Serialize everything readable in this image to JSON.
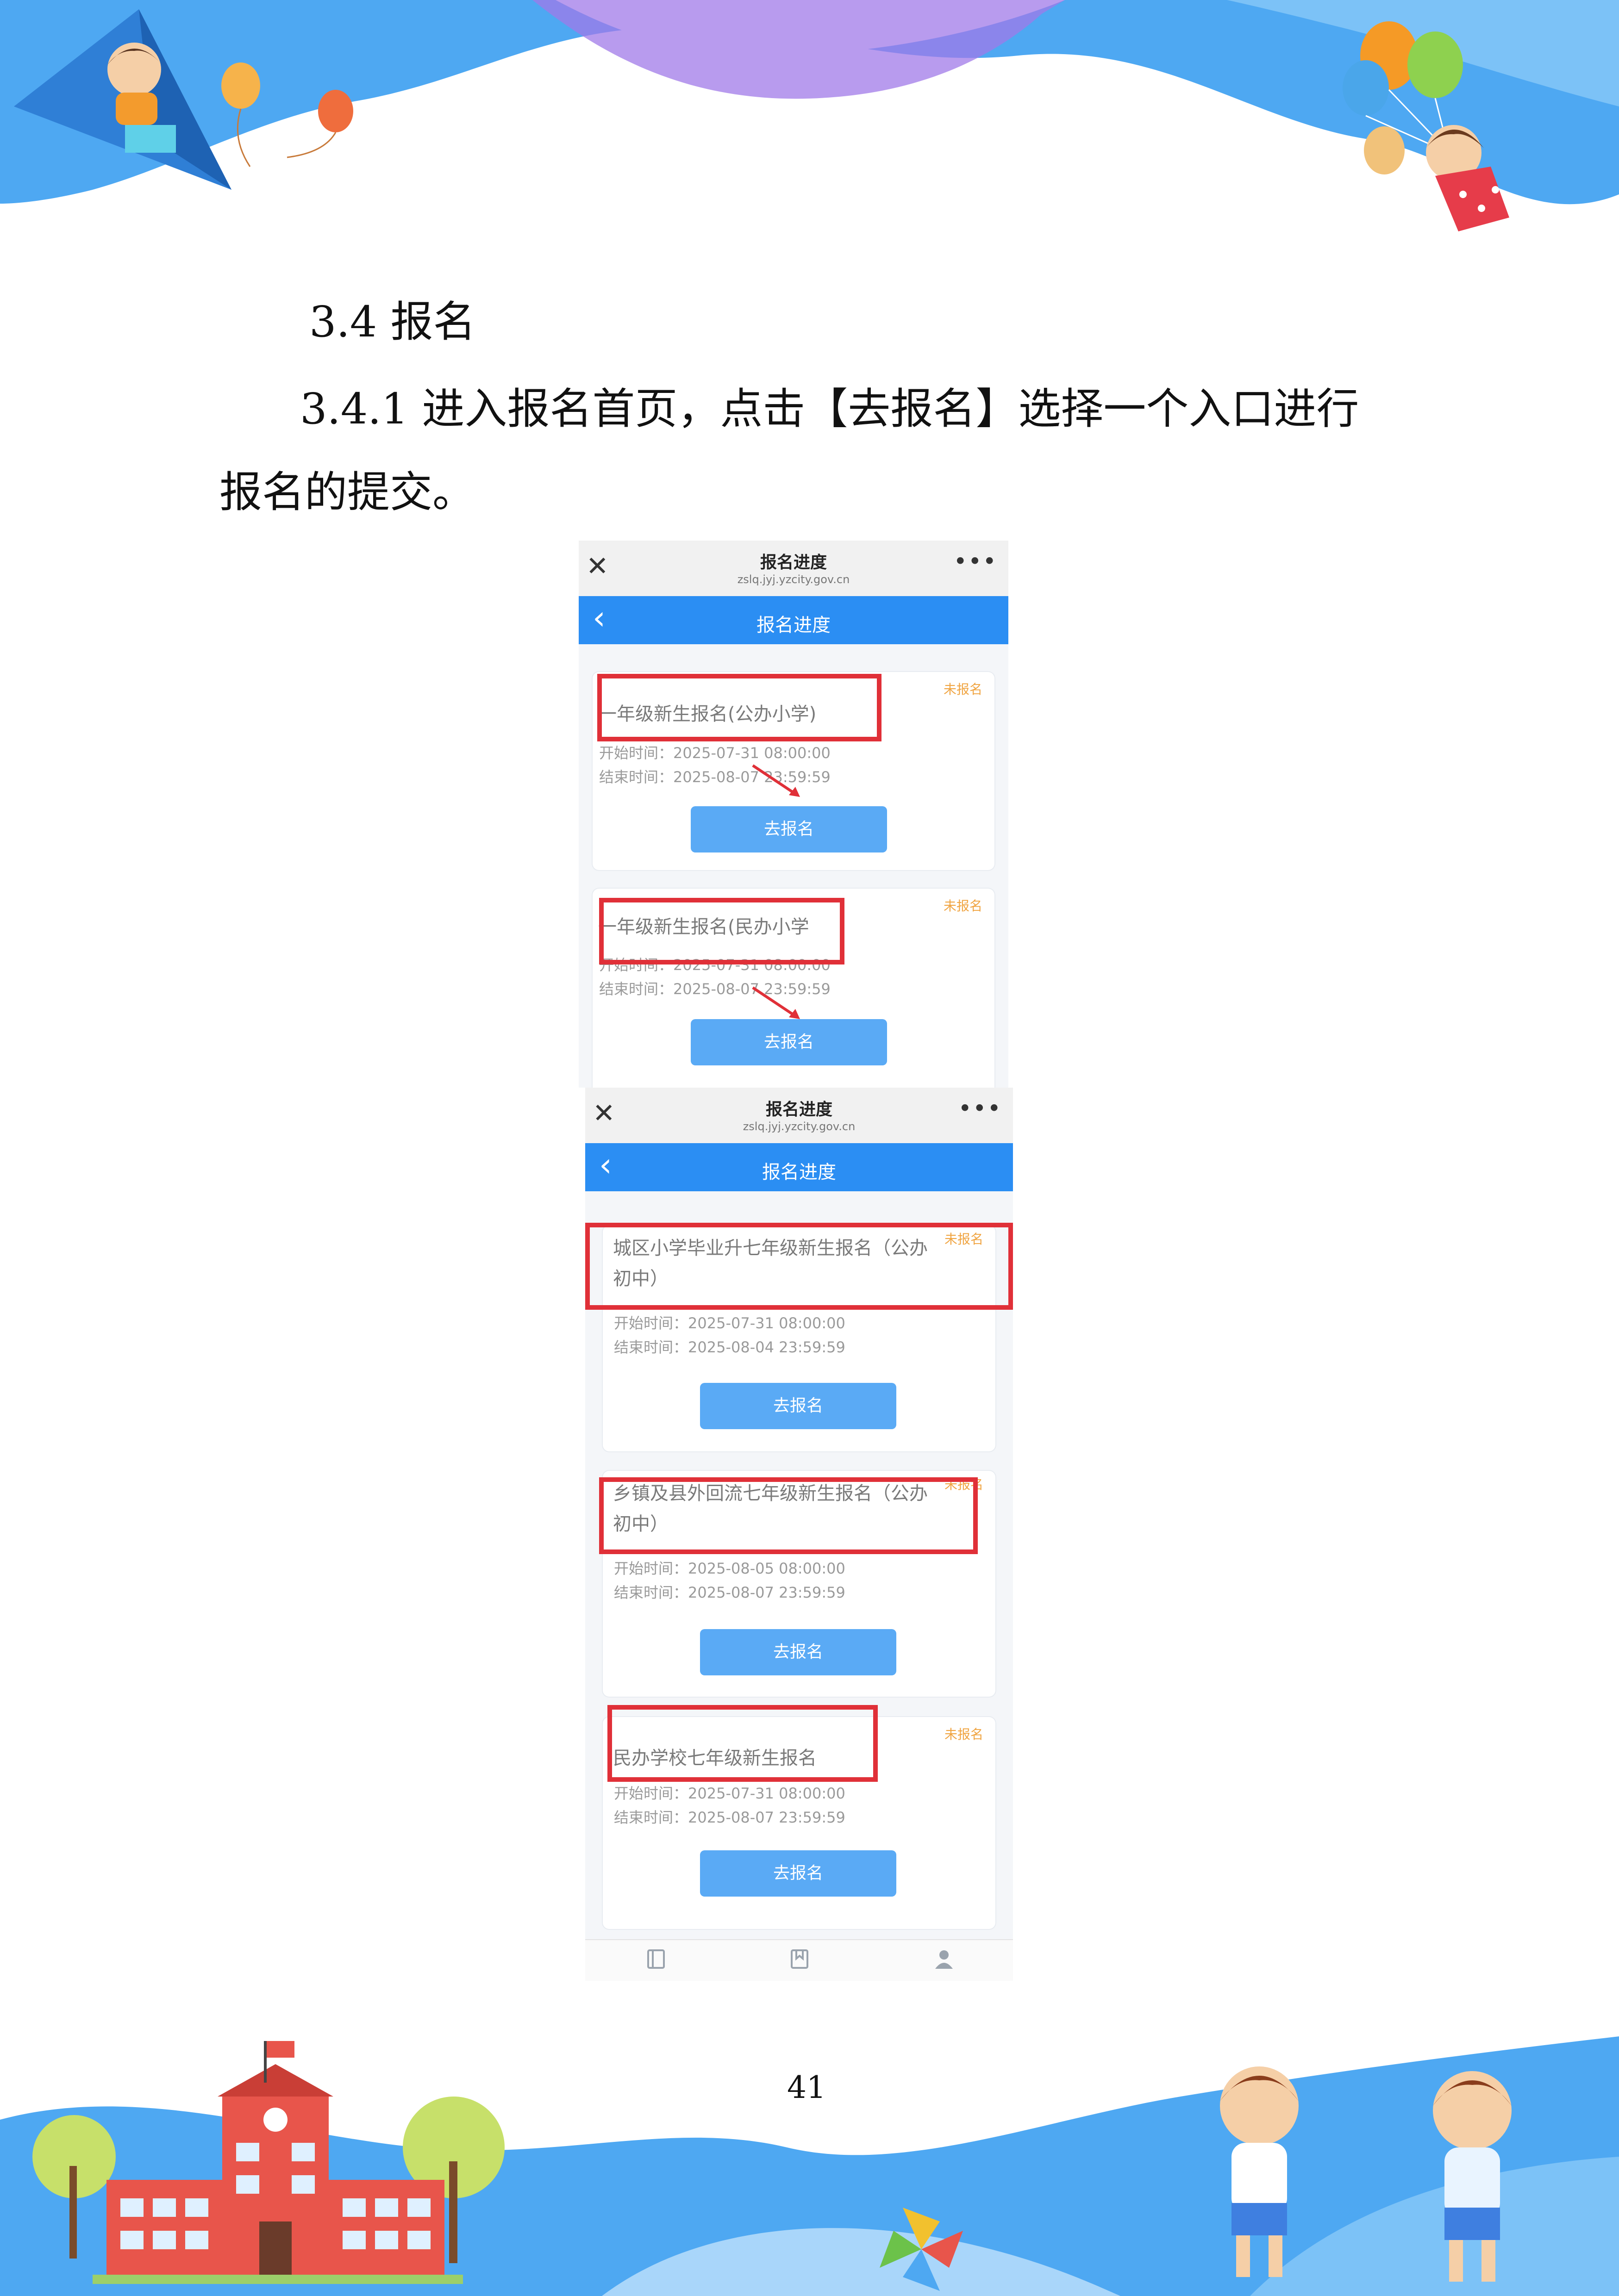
{
  "document": {
    "section_heading": "3.4 报名",
    "paragraph_line1": "3.4.1 进入报名首页，点击【去报名】选择一个入口进行",
    "paragraph_line2": "报名的提交。",
    "page_number": "41"
  },
  "colors": {
    "nav_blue": "#2b8ef3",
    "button_blue": "#5aaaf5",
    "highlight_red": "#e03038",
    "status_orange": "#f0a441"
  },
  "screenshot1": {
    "wechat_title": "报名进度",
    "wechat_url": "zslq.jyj.yzcity.gov.cn",
    "nav_title": "报名进度",
    "cards": [
      {
        "title": "一年级新生报名(公办小学)",
        "status": "未报名",
        "start": "开始时间：2025-07-31 08:00:00",
        "end": "结束时间：2025-08-07 23:59:59",
        "button": "去报名"
      },
      {
        "title": "一年级新生报名(民办小学",
        "status": "未报名",
        "start": "开始时间：2025-07-31 08:00:00",
        "end": "结束时间：2025-08-07 23:59:59",
        "button": "去报名"
      }
    ]
  },
  "screenshot2": {
    "wechat_title": "报名进度",
    "wechat_url": "zslq.jyj.yzcity.gov.cn",
    "nav_title": "报名进度",
    "cards": [
      {
        "title_line1": "城区小学毕业升七年级新生报名（公办",
        "title_line2": "初中）",
        "status": "未报名",
        "start": "开始时间：2025-07-31 08:00:00",
        "end": "结束时间：2025-08-04 23:59:59",
        "button": "去报名"
      },
      {
        "title_line1": "乡镇及县外回流七年级新生报名（公办",
        "title_line2": "初中）",
        "status": "未报名",
        "start": "开始时间：2025-08-05 08:00:00",
        "end": "结束时间：2025-08-07 23:59:59",
        "button": "去报名"
      },
      {
        "title": "民办学校七年级新生报名",
        "status": "未报名",
        "start": "开始时间：2025-07-31 08:00:00",
        "end": "结束时间：2025-08-07 23:59:59",
        "button": "去报名"
      }
    ]
  }
}
